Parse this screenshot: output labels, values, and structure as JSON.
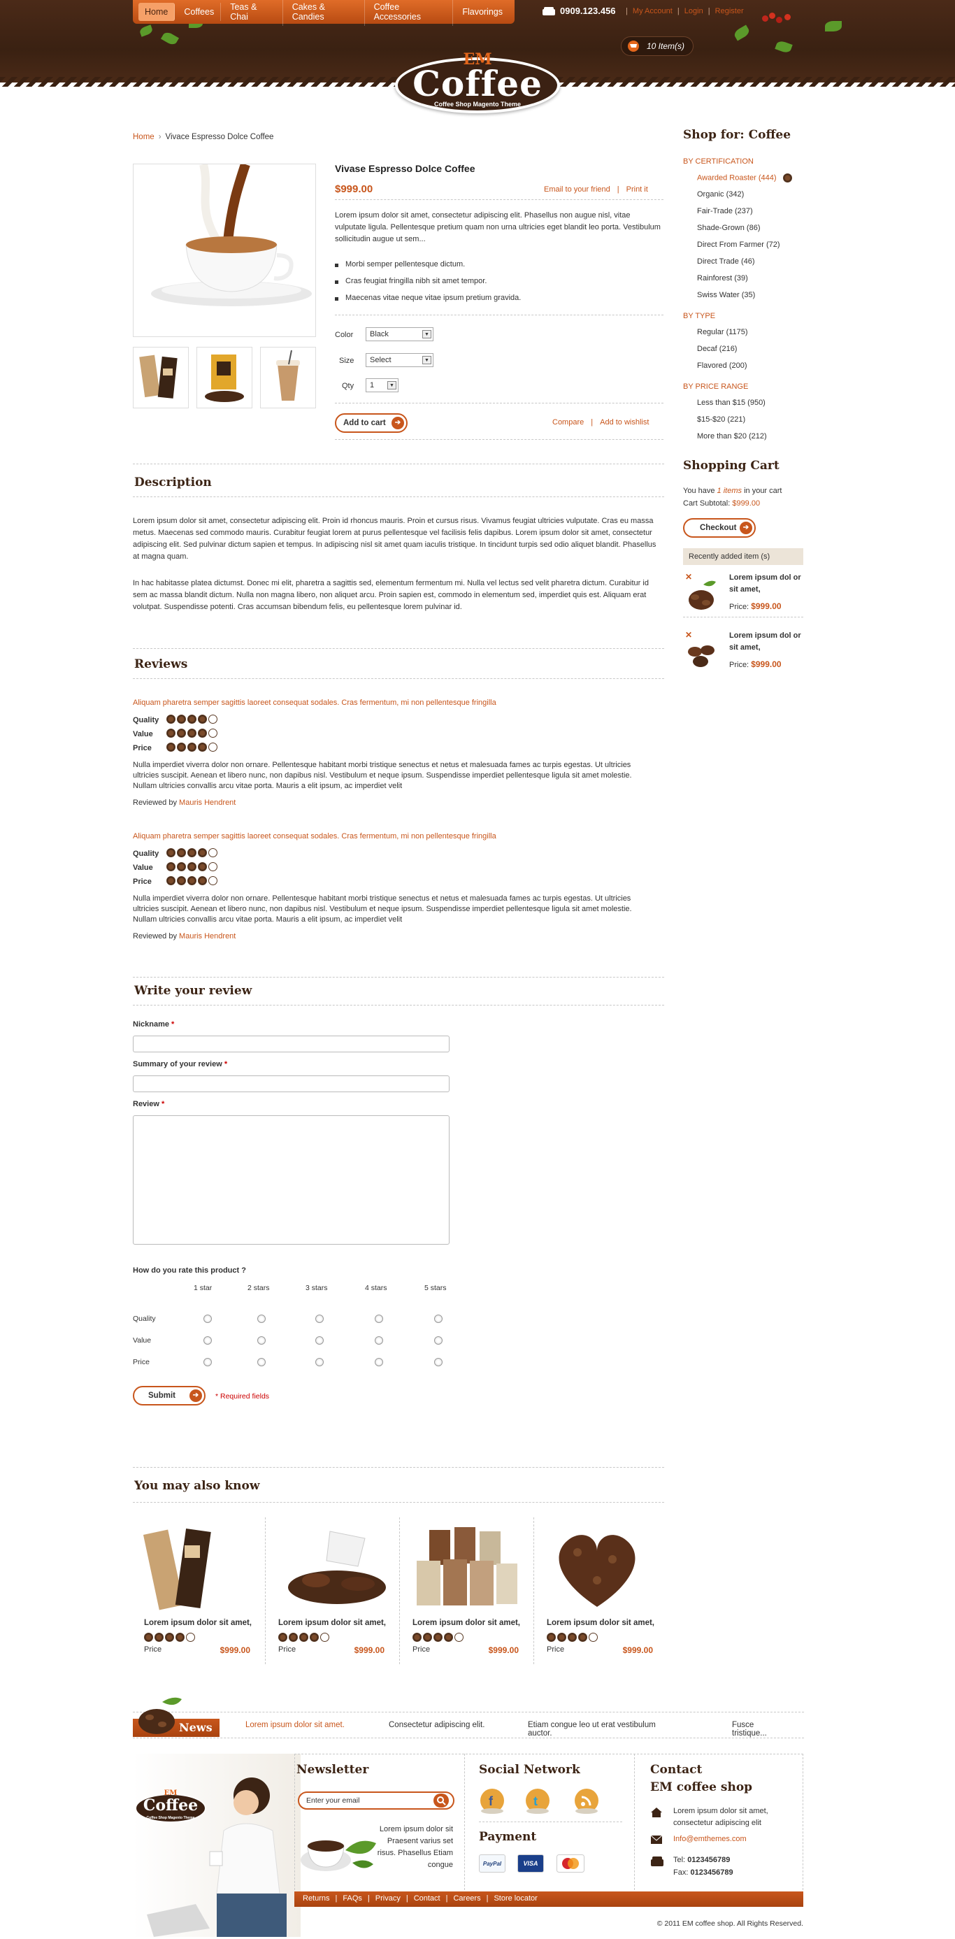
{
  "nav": {
    "items": [
      "Home",
      "Coffees",
      "Teas & Chai",
      "Cakes & Candies",
      "Coffee Accessories",
      "Flavorings"
    ]
  },
  "header": {
    "phone": "0909.123.456",
    "my_account": "My Account",
    "login": "Login",
    "register": "Register",
    "cart": "10 Item(s)",
    "logo_em": "EM",
    "logo_name": "Coffee",
    "logo_tagline": "Coffee Shop Magento Theme"
  },
  "breadcrumb": {
    "home": "Home",
    "current": "Vivace Espresso Dolce Coffee"
  },
  "product": {
    "title": "Vivase Espresso Dolce Coffee",
    "price": "$999.00",
    "email_friend": "Email to your friend",
    "print": "Print it",
    "description": "Lorem ipsum dolor sit amet, consectetur adipiscing elit. Phasellus non augue nisl, vitae vulputate ligula. Pellentesque pretium quam non urna ultricies eget blandit leo porta. Vestibulum sollicitudin augue ut sem...",
    "bullets": [
      "Morbi semper pellentesque dictum.",
      "Cras feugiat fringilla nibh sit amet tempor.",
      "Maecenas vitae neque vitae ipsum pretium gravida."
    ],
    "color_label": "Color",
    "color_value": "Black",
    "size_label": "Size",
    "size_value": "Select",
    "qty_label": "Qty",
    "qty_value": "1",
    "add_to_cart": "Add to cart",
    "compare": "Compare",
    "add_to_wishlist": "Add to wishlist"
  },
  "description": {
    "title": "Description",
    "p1": "Lorem ipsum dolor sit amet, consectetur adipiscing elit. Proin id rhoncus mauris. Proin et cursus risus. Vivamus feugiat ultricies vulputate. Cras eu massa metus. Maecenas sed commodo mauris. Curabitur feugiat lorem at purus pellentesque vel facilisis felis dapibus. Lorem ipsum dolor sit amet, consectetur adipiscing elit. Sed pulvinar dictum sapien et tempus. In adipiscing nisl sit amet quam iaculis tristique. In tincidunt turpis sed odio aliquet blandit. Phasellus at magna quam.",
    "p2": "In hac habitasse platea dictumst. Donec mi elit, pharetra a sagittis sed, elementum fermentum mi. Nulla vel lectus sed velit pharetra dictum. Curabitur id sem ac massa blandit dictum. Nulla non magna libero, non aliquet arcu. Proin sapien est, commodo in elementum sed, imperdiet quis est. Aliquam erat volutpat. Suspendisse potenti. Cras accumsan bibendum felis, eu pellentesque lorem pulvinar id."
  },
  "reviews": {
    "title": "Reviews",
    "items": [
      {
        "headline": "Aliquam pharetra semper sagittis laoreet consequat sodales. Cras fermentum, mi non pellentesque fringilla",
        "quality_label": "Quality",
        "value_label": "Value",
        "price_label": "Price",
        "ratings": {
          "quality": 4,
          "value": 4,
          "price": 4
        },
        "text": "Nulla imperdiet viverra dolor non ornare. Pellentesque habitant morbi tristique senectus et netus et malesuada fames ac turpis egestas. Ut ultricies ultricies suscipit. Aenean et libero nunc, non dapibus nisl. Vestibulum et neque ipsum. Suspendisse imperdiet pellentesque ligula sit amet molestie. Nullam ultricies convallis arcu vitae porta. Mauris a elit ipsum, ac imperdiet velit",
        "reviewed_by": "Reviewed by",
        "author": "Mauris Hendrent"
      },
      {
        "headline": "Aliquam pharetra semper sagittis laoreet consequat sodales. Cras fermentum, mi non pellentesque fringilla",
        "quality_label": "Quality",
        "value_label": "Value",
        "price_label": "Price",
        "ratings": {
          "quality": 4,
          "value": 4,
          "price": 4
        },
        "text": "Nulla imperdiet viverra dolor non ornare. Pellentesque habitant morbi tristique senectus et netus et malesuada fames ac turpis egestas. Ut ultricies ultricies suscipit. Aenean et libero nunc, non dapibus nisl. Vestibulum et neque ipsum. Suspendisse imperdiet pellentesque ligula sit amet molestie. Nullam ultricies convallis arcu vitae porta. Mauris a elit ipsum, ac imperdiet velit",
        "reviewed_by": "Reviewed by",
        "author": "Mauris Hendrent"
      }
    ]
  },
  "write_review": {
    "title": "Write your review",
    "nickname": "Nickname",
    "summary": "Summary of your review",
    "review": "Review",
    "req_mark": "*",
    "rate_question": "How do you rate this product ?",
    "columns": [
      "1 star",
      "2 stars",
      "3 stars",
      "4 stars",
      "5 stars"
    ],
    "rows": [
      "Quality",
      "Value",
      "Price"
    ],
    "submit": "Submit",
    "required_note": "* Required fields"
  },
  "also_know": {
    "title": "You may also know",
    "items": [
      {
        "name": "Lorem ipsum dolor sit amet,",
        "price_label": "Price",
        "price": "$999.00",
        "rating": 4
      },
      {
        "name": "Lorem ipsum dolor sit amet,",
        "price_label": "Price",
        "price": "$999.00",
        "rating": 4
      },
      {
        "name": "Lorem ipsum dolor sit amet,",
        "price_label": "Price",
        "price": "$999.00",
        "rating": 4
      },
      {
        "name": "Lorem ipsum dolor sit amet,",
        "price_label": "Price",
        "price": "$999.00",
        "rating": 4
      }
    ]
  },
  "sidebar": {
    "title": "Shop for: Coffee",
    "groups": [
      {
        "title": "BY CERTIFICATION",
        "items": [
          "Awarded Roaster (444)",
          "Organic (342)",
          "Fair-Trade (237)",
          "Shade-Grown (86)",
          "Direct From Farmer (72)",
          "Direct Trade (46)",
          "Rainforest (39)",
          "Swiss Water (35)"
        ]
      },
      {
        "title": "BY TYPE",
        "items": [
          "Regular (1175)",
          "Decaf (216)",
          "Flavored (200)"
        ]
      },
      {
        "title": "BY PRICE RANGE",
        "items": [
          "Less than $15 (950)",
          "$15-$20 (221)",
          "More than $20 (212)"
        ]
      }
    ],
    "cart": {
      "title": "Shopping Cart",
      "you_have": "You have",
      "items_link": "1 items",
      "in_cart": "in your cart",
      "subtotal_label": "Cart Subtotal:",
      "subtotal": "$999.00",
      "checkout": "Checkout",
      "recent": "Recently added item (s)",
      "items": [
        {
          "name": "Lorem ipsum dol or sit amet,",
          "price_label": "Price:",
          "price": "$999.00"
        },
        {
          "name": "Lorem ipsum dol or sit amet,",
          "price_label": "Price:",
          "price": "$999.00"
        }
      ]
    }
  },
  "news": {
    "label": "News",
    "items": [
      "Lorem ipsum dolor sit amet.",
      "Consectetur adipiscing elit.",
      "Etiam congue leo ut erat vestibulum auctor.",
      "Fusce tristique..."
    ]
  },
  "footer": {
    "newsletter_title": "Newsletter",
    "newsletter_placeholder": "Enter your email",
    "newsletter_text": "Lorem ipsum dolor sit Praesent varius set risus. Phasellus Etiam congue",
    "social_title": "Social Network",
    "payment_title": "Payment",
    "payments": [
      "PayPal",
      "VISA",
      "MasterCard"
    ],
    "contact_title": "Contact",
    "contact_shop": "EM coffee shop",
    "address": "Lorem ipsum dolor sit amet, consectetur adipiscing elit",
    "email": "Info@emthemes.com",
    "tel_label": "Tel:",
    "tel": "0123456789",
    "fax_label": "Fax:",
    "fax": "0123456789",
    "links": [
      "Returns",
      "FAQs",
      "Privacy",
      "Contact",
      "Careers",
      "Store locator"
    ],
    "copyright": "© 2011 EM coffee shop. All Rights Reserved."
  },
  "colors": {
    "accent": "#c8561c",
    "brown": "#3c2415"
  }
}
